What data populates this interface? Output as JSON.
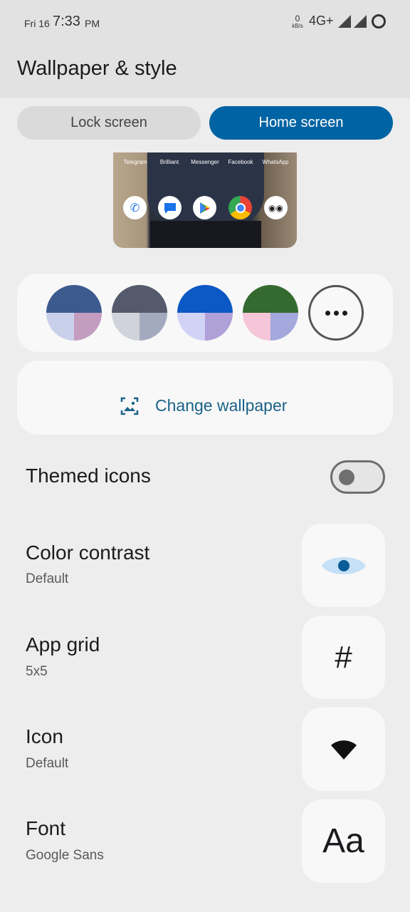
{
  "status_bar": {
    "date": "Fri 16",
    "time": "7:33",
    "ampm": "PM",
    "speed_value": "0",
    "speed_unit": "kB/s",
    "network": "4G+"
  },
  "header": {
    "title": "Wallpaper & style"
  },
  "tabs": [
    {
      "label": "Lock screen",
      "selected": false
    },
    {
      "label": "Home screen",
      "selected": true
    }
  ],
  "preview": {
    "apps_top": [
      "Telegram",
      "Brilliant",
      "Messenger",
      "Facebook",
      "WhatsApp"
    ],
    "apps_bottom_icons": [
      "phone-icon",
      "messages-icon",
      "play-store-icon",
      "chrome-icon",
      "camera-app-icon"
    ]
  },
  "palettes": [
    {
      "top": "#3d5a8f",
      "bottom_left": "#c9d0ea",
      "bottom_right": "#c39cc0"
    },
    {
      "top": "#545a6b",
      "bottom_left": "#d0d3db",
      "bottom_right": "#a3aac0"
    },
    {
      "top": "#0c58c4",
      "bottom_left": "#d1d3f6",
      "bottom_right": "#b0a0d8"
    },
    {
      "top": "#346a30",
      "bottom_left": "#f5c5d8",
      "bottom_right": "#a3a8dd"
    }
  ],
  "change_wallpaper": {
    "label": "Change wallpaper"
  },
  "themed_icons": {
    "label": "Themed icons",
    "enabled": false
  },
  "settings": [
    {
      "title": "Color contrast",
      "subtitle": "Default",
      "icon": "eye-icon"
    },
    {
      "title": "App grid",
      "subtitle": "5x5",
      "icon": "hash-icon",
      "glyph": "#"
    },
    {
      "title": "Icon",
      "subtitle": "Default",
      "icon": "wifi-icon"
    },
    {
      "title": "Font",
      "subtitle": "Google Sans",
      "icon": "font-icon",
      "glyph": "Aa"
    }
  ],
  "colors": {
    "accent": "#0063a3",
    "link": "#1a6288",
    "background": "#ededed",
    "card": "#f8f8f8"
  }
}
